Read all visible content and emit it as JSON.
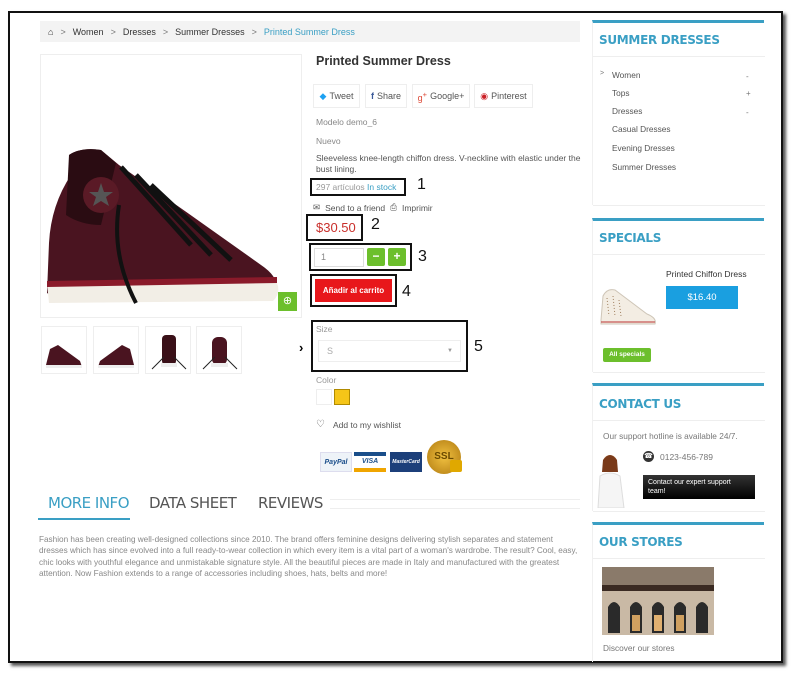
{
  "breadcrumb": {
    "home_icon": "home-icon",
    "items": [
      "Women",
      "Dresses",
      "Summer Dresses"
    ],
    "current": "Printed Summer Dress",
    "separator": ">"
  },
  "product": {
    "title": "Printed Summer Dress",
    "share": [
      {
        "icon": "twitter-icon",
        "label": "Tweet"
      },
      {
        "icon": "facebook-icon",
        "label": "Share"
      },
      {
        "icon": "google-plus-icon",
        "label": "Google+"
      },
      {
        "icon": "pinterest-icon",
        "label": "Pinterest"
      }
    ],
    "model": "Modelo demo_6",
    "condition": "Nuevo",
    "description": "Sleeveless knee-length chiffon dress. V-neckline with elastic under the bust lining.",
    "stock_count": "297 artículos",
    "stock_status": "In stock",
    "send_to_friend": "Send to a friend",
    "print": "Imprimir",
    "price": "$30.50",
    "quantity": "1",
    "minus": "−",
    "plus": "+",
    "add_to_cart": "Añadir al carrito",
    "size_label": "Size",
    "size_value": "S",
    "color_label": "Color",
    "colors": [
      "#ffffff",
      "#f5c518"
    ],
    "wishlist": "Add to my wishlist",
    "payments": [
      "PayPal",
      "VISA",
      "MasterCard",
      "SSL"
    ],
    "zoom_icon": "⊕"
  },
  "annotations": [
    "1",
    "2",
    "3",
    "4",
    "5"
  ],
  "tabs": [
    {
      "label": "MORE INFO",
      "active": true
    },
    {
      "label": "DATA SHEET",
      "active": false
    },
    {
      "label": "REVIEWS",
      "active": false
    }
  ],
  "more_info": "Fashion has been creating well-designed collections since 2010. The brand offers feminine designs delivering stylish separates and statement dresses which has since evolved into a full ready-to-wear collection in which every item is a vital part of a woman's wardrobe. The result? Cool, easy, chic looks with youthful elegance and unmistakable signature style. All the beautiful pieces are made in Italy and manufactured with the greatest attention. Now Fashion extends to a range of accessories including shoes, hats, belts and more!",
  "sidebar": {
    "categories": {
      "title": "SUMMER DRESSES",
      "items": [
        {
          "label": "Women",
          "toggle": "-"
        },
        {
          "label": "Tops",
          "toggle": "+"
        },
        {
          "label": "Dresses",
          "toggle": "-"
        },
        {
          "label": "Casual Dresses"
        },
        {
          "label": "Evening Dresses"
        },
        {
          "label": "Summer Dresses"
        }
      ]
    },
    "specials": {
      "title": "SPECIALS",
      "product_name": "Printed Chiffon Dress",
      "price": "$16.40",
      "all_specials": "All specials"
    },
    "contact": {
      "title": "CONTACT US",
      "hotline": "Our support hotline is available 24/7.",
      "phone": "0123-456-789",
      "cta": "Contact our expert support team!"
    },
    "stores": {
      "title": "OUR STORES",
      "link": "Discover our stores"
    }
  },
  "colors": {
    "accent": "#3a9fc4",
    "green": "#6cbf2c",
    "cart_red": "#e8171b",
    "price_red": "#c9302c",
    "special_blue": "#1a9fe0"
  }
}
